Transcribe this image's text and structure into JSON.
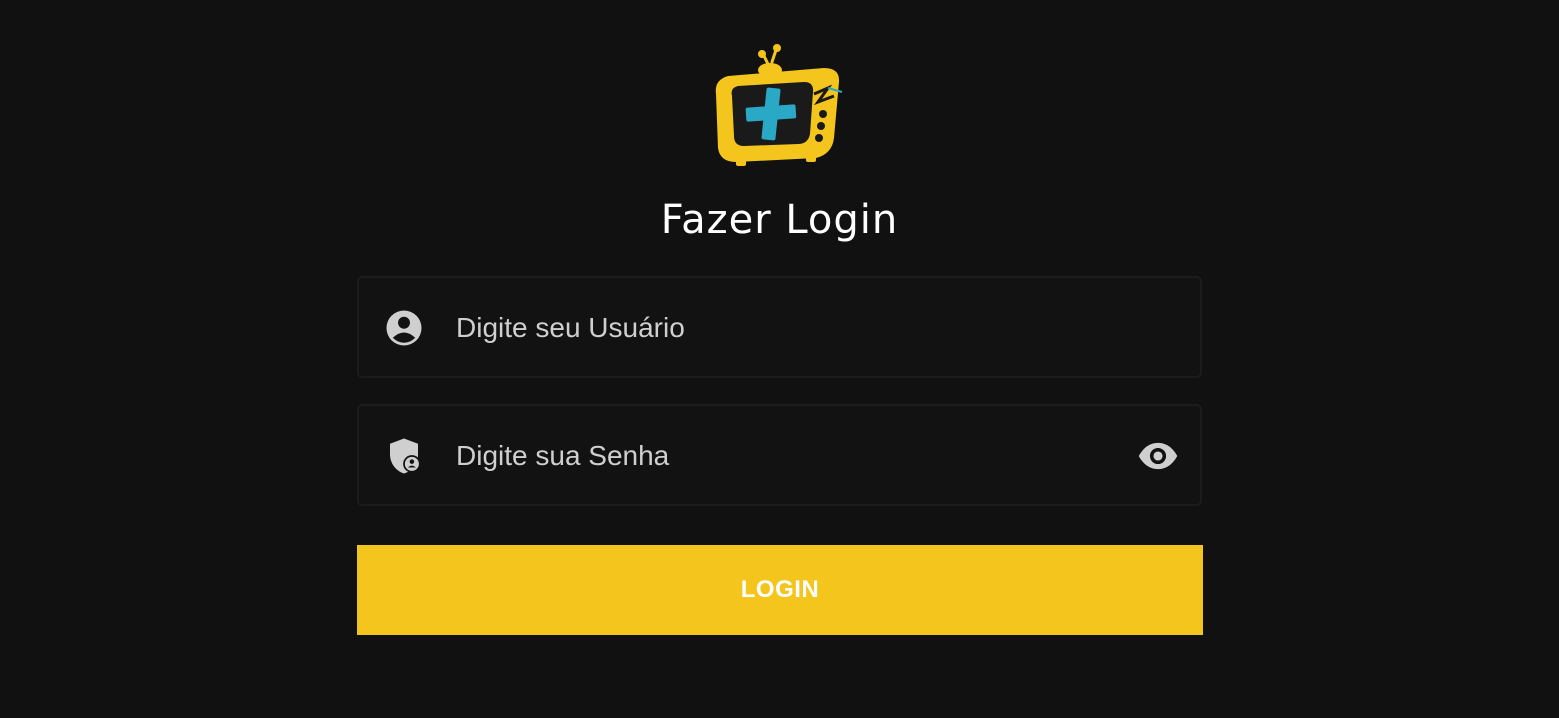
{
  "logo": {
    "icon": "tv-plus-logo-icon",
    "colors": {
      "body": "#f4c51c",
      "plus": "#29a9c6",
      "outline": "#1a1a1a"
    }
  },
  "page_title": "Fazer Login",
  "username_field": {
    "icon": "account-circle-icon",
    "placeholder": "Digite seu Usuário",
    "value": ""
  },
  "password_field": {
    "icon": "shield-account-icon",
    "placeholder": "Digite sua Senha",
    "value": "",
    "toggle_icon": "eye-icon"
  },
  "login_button": {
    "label": "LOGIN"
  },
  "colors": {
    "background": "#111111",
    "accent": "#f4c51c",
    "field_border": "#1c1c1c",
    "placeholder_text": "#cfcfcf"
  }
}
